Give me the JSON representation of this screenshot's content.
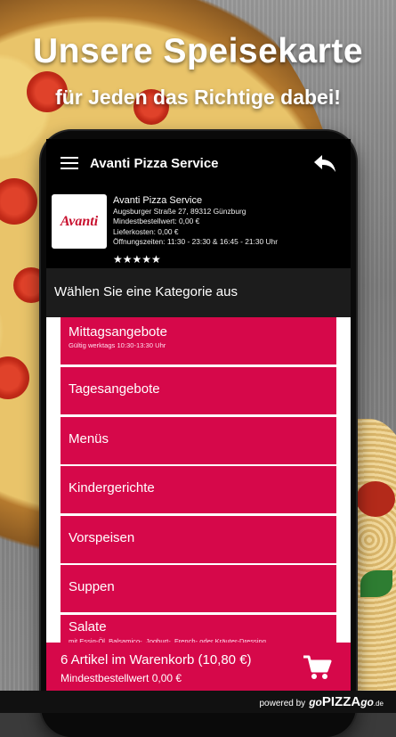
{
  "promo": {
    "headline": "Unsere Speisekarte",
    "subheadline": "für Jeden das Richtige dabei!"
  },
  "appbar": {
    "title": "Avanti Pizza Service"
  },
  "restaurant": {
    "logo_text": "Avanti",
    "name": "Avanti Pizza Service",
    "address": "Augsburger Straße 27, 89312 Günzburg",
    "min_order": "Mindestbestellwert: 0,00 €",
    "delivery_cost": "Lieferkosten: 0,00 €",
    "opening_hours": "Öffnungszeiten: 11:30 - 23:30 & 16:45 - 21:30 Uhr",
    "rating": 5,
    "stars": "★★★★★"
  },
  "category_prompt": "Wählen Sie eine Kategorie aus",
  "categories": [
    {
      "title": "Mittagsangebote",
      "subtitle": "Gültig werktags 10:30-13:30 Uhr"
    },
    {
      "title": "Tagesangebote",
      "subtitle": ""
    },
    {
      "title": "Menüs",
      "subtitle": ""
    },
    {
      "title": "Kindergerichte",
      "subtitle": ""
    },
    {
      "title": "Vorspeisen",
      "subtitle": ""
    },
    {
      "title": "Suppen",
      "subtitle": ""
    },
    {
      "title": "Salate",
      "subtitle": "mit Essig-Öl, Balsamico-, Joghurt-, French- oder Kräuter-Dressing"
    }
  ],
  "cart": {
    "summary": "6 Artikel im Warenkorb (10,80 €)",
    "min_order": "Mindestbestellwert 0,00 €"
  },
  "footer": {
    "powered_by": "powered by",
    "brand_go": "go",
    "brand_pizza": "PIZZA",
    "brand_go2": "go",
    "brand_tld": ".de"
  },
  "colors": {
    "accent": "#d6084a",
    "appbar": "#000000",
    "category_bar": "#1c1c1c"
  },
  "icons": [
    "menu-icon",
    "back-arrow-icon",
    "cart-icon",
    "star-icon"
  ]
}
